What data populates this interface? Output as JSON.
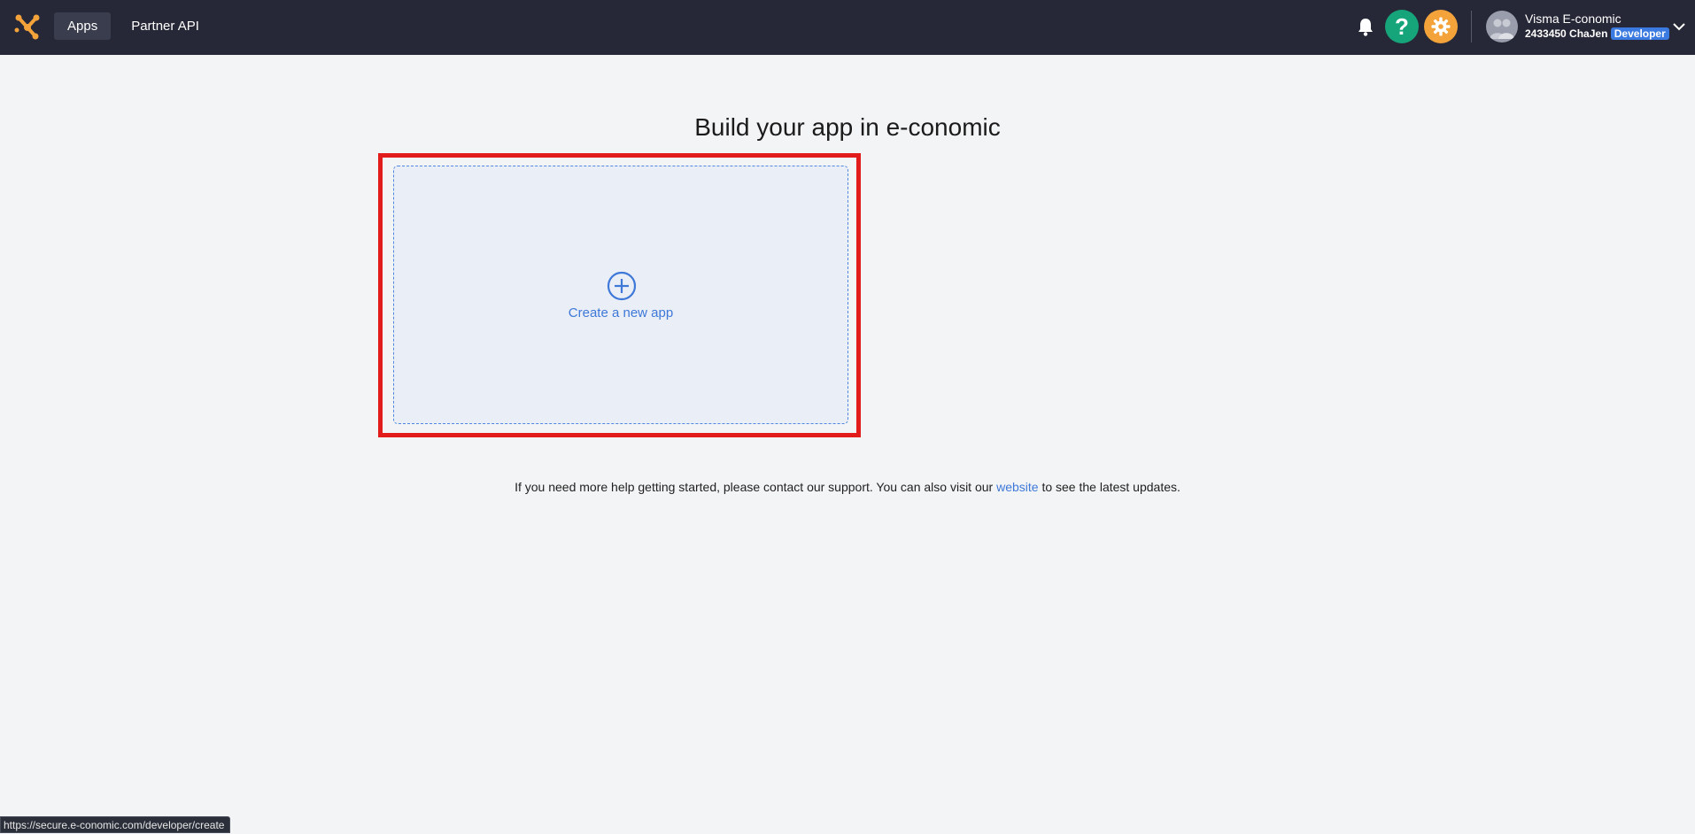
{
  "topbar": {
    "nav": [
      {
        "label": "Apps",
        "active": true
      },
      {
        "label": "Partner API",
        "active": false
      }
    ],
    "help_label": "?",
    "user": {
      "name": "Visma E-conomic",
      "account": "2433450 ChaJen",
      "role": "Developer"
    }
  },
  "main": {
    "title": "Build your app in e-conomic",
    "create_card": {
      "label": "Create a new app"
    },
    "help_text": {
      "before": "If you need more help getting started, please contact our support. You can also visit our ",
      "link": "website",
      "after": " to see the latest updates."
    }
  },
  "status_url": "https://secure.e-conomic.com/developer/create",
  "colors": {
    "topbar_bg": "#262837",
    "help_green": "#16a57a",
    "gear_orange": "#f3a33a",
    "accent_blue": "#3e78d8",
    "highlight_red": "#e21b1b",
    "logo_orange": "#f3a33a"
  },
  "icons": [
    "logo-icon",
    "bell-icon",
    "help-icon",
    "gear-icon",
    "avatar-icon",
    "chevron-down-icon",
    "plus-circle-icon"
  ]
}
